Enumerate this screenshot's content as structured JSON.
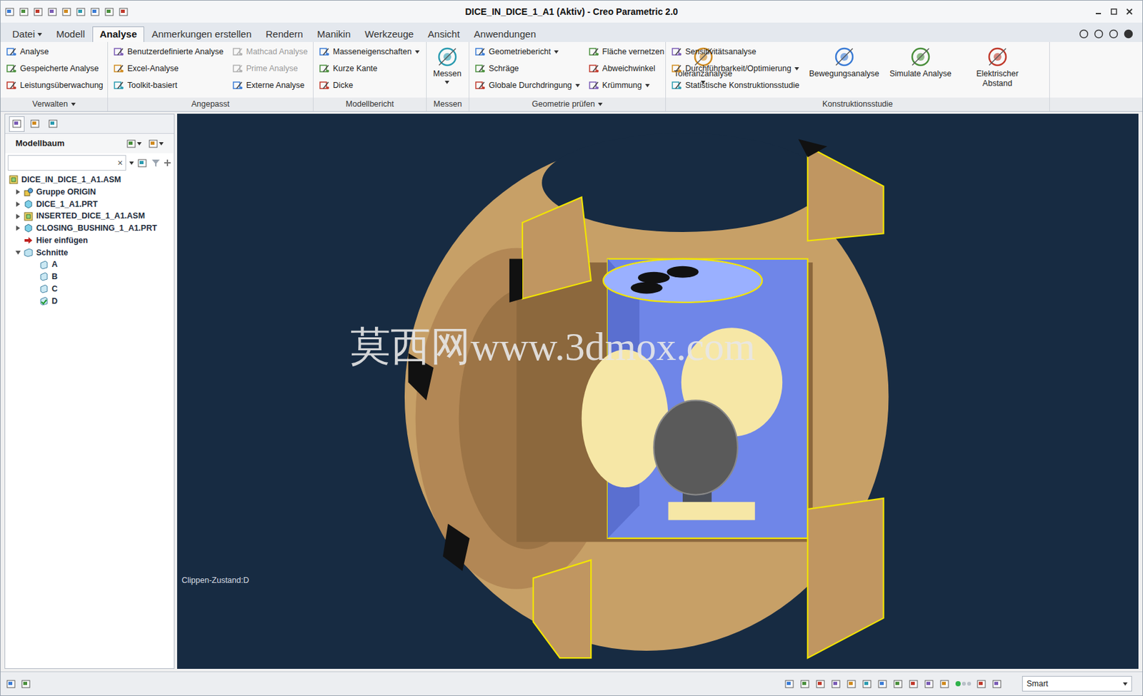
{
  "window": {
    "title": "DICE_IN_DICE_1_A1 (Aktiv) - Creo Parametric 2.0"
  },
  "tabs": [
    {
      "label": "Datei",
      "selected": false,
      "dropdown": true
    },
    {
      "label": "Modell",
      "selected": false,
      "dropdown": false
    },
    {
      "label": "Analyse",
      "selected": true,
      "dropdown": false
    },
    {
      "label": "Anmerkungen erstellen",
      "selected": false,
      "dropdown": false
    },
    {
      "label": "Rendern",
      "selected": false,
      "dropdown": false
    },
    {
      "label": "Manikin",
      "selected": false,
      "dropdown": false
    },
    {
      "label": "Werkzeuge",
      "selected": false,
      "dropdown": false
    },
    {
      "label": "Ansicht",
      "selected": false,
      "dropdown": false
    },
    {
      "label": "Anwendungen",
      "selected": false,
      "dropdown": false
    }
  ],
  "ribbon": {
    "groups": [
      {
        "label": "Verwalten",
        "dropdown": true,
        "columns": [
          {
            "kind": "small",
            "items": [
              {
                "label": "Analyse",
                "disabled": false,
                "dropdown": false
              },
              {
                "label": "Gespeicherte Analyse",
                "disabled": false,
                "dropdown": false
              },
              {
                "label": "Leistungsüberwachung",
                "disabled": false,
                "dropdown": false
              }
            ]
          }
        ]
      },
      {
        "label": "Angepasst",
        "dropdown": false,
        "columns": [
          {
            "kind": "small",
            "items": [
              {
                "label": "Benutzerdefinierte Analyse",
                "disabled": false,
                "dropdown": false
              },
              {
                "label": "Excel-Analyse",
                "disabled": false,
                "dropdown": false
              },
              {
                "label": "Toolkit-basiert",
                "disabled": false,
                "dropdown": false
              }
            ]
          },
          {
            "kind": "small",
            "items": [
              {
                "label": "Mathcad Analyse",
                "disabled": true,
                "dropdown": false
              },
              {
                "label": "Prime Analyse",
                "disabled": true,
                "dropdown": false
              },
              {
                "label": "Externe Analyse",
                "disabled": false,
                "dropdown": false
              }
            ]
          }
        ]
      },
      {
        "label": "Modellbericht",
        "dropdown": false,
        "columns": [
          {
            "kind": "small",
            "items": [
              {
                "label": "Masseneigenschaften",
                "disabled": false,
                "dropdown": true
              },
              {
                "label": "Kurze Kante",
                "disabled": false,
                "dropdown": false
              },
              {
                "label": "Dicke",
                "disabled": false,
                "dropdown": false
              }
            ]
          }
        ]
      },
      {
        "label": "Messen",
        "dropdown": false,
        "columns": [
          {
            "kind": "large",
            "items": [
              {
                "label": "Messen",
                "disabled": false,
                "dropdown": true
              }
            ]
          }
        ]
      },
      {
        "label": "Geometrie prüfen",
        "dropdown": true,
        "columns": [
          {
            "kind": "small",
            "items": [
              {
                "label": "Geometriebericht",
                "disabled": false,
                "dropdown": true
              },
              {
                "label": "Schräge",
                "disabled": false,
                "dropdown": false
              },
              {
                "label": "Globale Durchdringung",
                "disabled": false,
                "dropdown": true
              }
            ]
          },
          {
            "kind": "small",
            "items": [
              {
                "label": "Fläche vernetzen",
                "disabled": false,
                "dropdown": false
              },
              {
                "label": "Abweichwinkel",
                "disabled": false,
                "dropdown": false
              },
              {
                "label": "Krümmung",
                "disabled": false,
                "dropdown": true
              }
            ]
          },
          {
            "kind": "large",
            "items": [
              {
                "label": "Toleranzanalyse",
                "disabled": false,
                "dropdown": true
              }
            ]
          }
        ]
      },
      {
        "label": "Konstruktionsstudie",
        "dropdown": false,
        "columns": [
          {
            "kind": "small",
            "items": [
              {
                "label": "Sensitivitätsanalyse",
                "disabled": false,
                "dropdown": false
              },
              {
                "label": "Durchführbarkeit/Optimierung",
                "disabled": false,
                "dropdown": true
              },
              {
                "label": "Statistische Konstruktionsstudie",
                "disabled": false,
                "dropdown": false
              }
            ]
          },
          {
            "kind": "large",
            "items": [
              {
                "label": "Bewegungsanalyse",
                "disabled": false,
                "dropdown": false
              }
            ]
          },
          {
            "kind": "large",
            "items": [
              {
                "label": "Simulate Analyse",
                "disabled": false,
                "dropdown": false
              }
            ]
          },
          {
            "kind": "large",
            "items": [
              {
                "label": "Elektrischer Abstand",
                "disabled": false,
                "dropdown": false
              }
            ]
          }
        ]
      }
    ]
  },
  "model_tree": {
    "title": "Modellbaum",
    "search": {
      "value": "",
      "clear": "×"
    },
    "items": [
      {
        "label": "DICE_IN_DICE_1_A1.ASM",
        "level": 0,
        "expandable": false,
        "expanded": false,
        "kind": "asm"
      },
      {
        "label": "Gruppe ORIGIN",
        "level": 1,
        "expandable": true,
        "expanded": false,
        "kind": "group"
      },
      {
        "label": "DICE_1_A1.PRT",
        "level": 1,
        "expandable": true,
        "expanded": false,
        "kind": "part"
      },
      {
        "label": "INSERTED_DICE_1_A1.ASM",
        "level": 1,
        "expandable": true,
        "expanded": false,
        "kind": "asm"
      },
      {
        "label": "CLOSING_BUSHING_1_A1.PRT",
        "level": 1,
        "expandable": true,
        "expanded": false,
        "kind": "part"
      },
      {
        "label": "Hier einfügen",
        "level": 1,
        "expandable": false,
        "expanded": false,
        "kind": "insert"
      },
      {
        "label": "Schnitte",
        "level": 1,
        "expandable": true,
        "expanded": true,
        "kind": "folder"
      },
      {
        "label": "A",
        "level": 2,
        "expandable": false,
        "expanded": false,
        "kind": "section"
      },
      {
        "label": "B",
        "level": 2,
        "expandable": false,
        "expanded": false,
        "kind": "section"
      },
      {
        "label": "C",
        "level": 2,
        "expandable": false,
        "expanded": false,
        "kind": "section"
      },
      {
        "label": "D",
        "level": 2,
        "expandable": false,
        "expanded": false,
        "kind": "section-active"
      }
    ]
  },
  "viewport": {
    "clip_state": "Clippen-Zustand:D",
    "watermark": "莫西网www.3dmox.com"
  },
  "status_bar": {
    "filter": "Smart"
  }
}
